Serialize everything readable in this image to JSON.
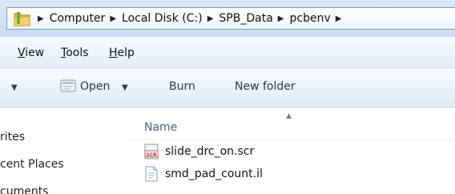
{
  "address": {
    "crumbs": [
      "Computer",
      "Local Disk (C:)",
      "SPB_Data",
      "pcbenv"
    ]
  },
  "menu": {
    "view": {
      "first": "V",
      "rest": "iew"
    },
    "tools": {
      "first": "T",
      "rest": "ools"
    },
    "help": {
      "first": "H",
      "rest": "elp"
    }
  },
  "toolbar": {
    "open_label": "Open",
    "burn_label": "Burn",
    "new_folder_label": "New folder"
  },
  "nav": {
    "items": [
      "rites",
      "cent Places",
      "cuments"
    ]
  },
  "filelist": {
    "column_name": "Name",
    "files": [
      {
        "name": "slide_drc_on.scr",
        "icon": "script-file-icon",
        "icon_text": "SCR"
      },
      {
        "name": "smd_pad_count.il",
        "icon": "text-file-icon"
      }
    ]
  },
  "colors": {
    "address_bg": "#c9dcf1",
    "toolbar_text": "#1e395b",
    "header_text": "#4c607a"
  }
}
